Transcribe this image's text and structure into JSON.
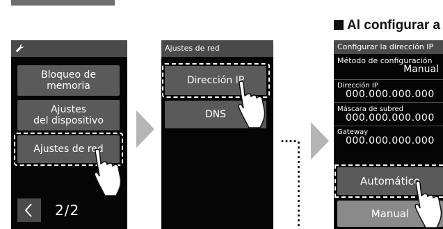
{
  "section_heading": "Al configurar a",
  "panel1": {
    "header_icon": "wrench-icon",
    "buttons": [
      "Bloqueo de memoria",
      "Ajustes del dispositivo",
      "Ajustes de red"
    ],
    "button_lines": [
      [
        "Bloqueo de",
        "memoria"
      ],
      [
        "Ajustes",
        "del dispositivo"
      ],
      [
        "Ajustes de red"
      ]
    ],
    "page_indicator": "2/2",
    "back_icon": "chevron-left-icon"
  },
  "panel2": {
    "title": "Ajustes de red",
    "buttons": [
      "Dirección IP",
      "DNS"
    ]
  },
  "panel3": {
    "title": "Configurar la dirección IP",
    "method_label": "Método de configuración",
    "method_value": "Manual",
    "fields": [
      {
        "label": "Dirección IP",
        "value": "000.000.000.000"
      },
      {
        "label": "Máscara de subred",
        "value": "000.000.000.000"
      },
      {
        "label": "Gateway",
        "value": "000.000.000.000"
      }
    ],
    "buttons": [
      "Automático",
      "Manual"
    ]
  },
  "colors": {
    "screen_bg": "#050505",
    "button": "#5a5a5a",
    "button_selected": "#8a8a8a",
    "header": "#4a4a4a",
    "arrow": "#b5b5b5"
  }
}
